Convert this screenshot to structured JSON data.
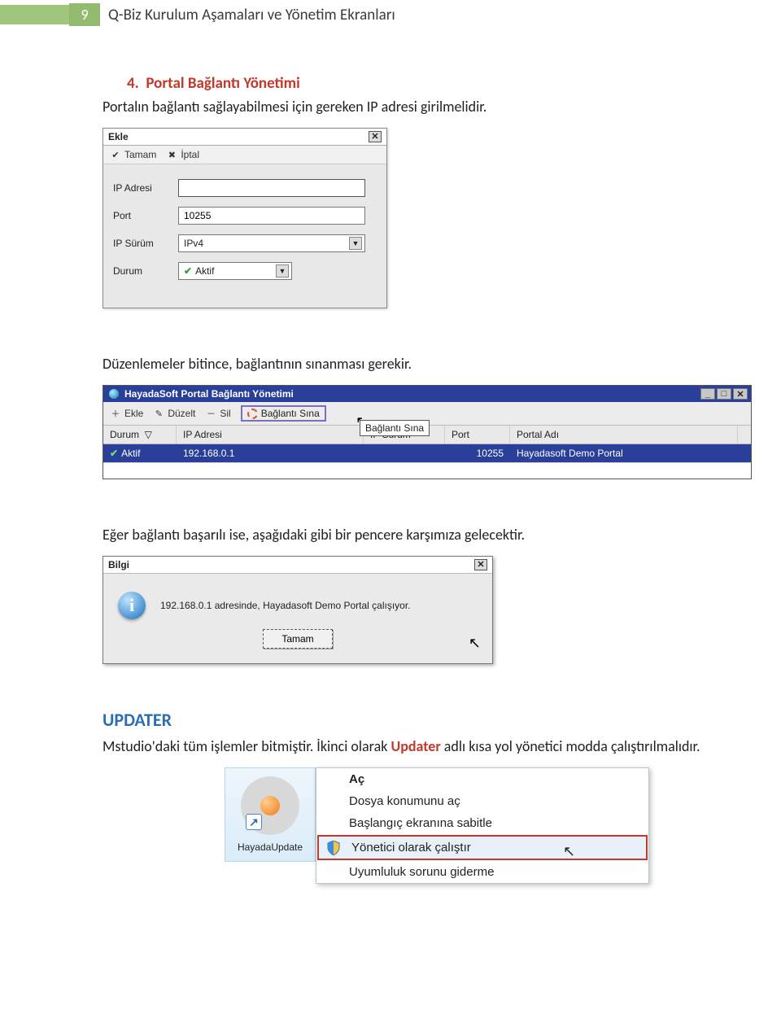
{
  "page": {
    "number": "9",
    "title": "Q-Biz Kurulum Aşamaları ve Yönetim Ekranları"
  },
  "section": {
    "num": "4.",
    "title": "Portal Bağlantı Yönetimi",
    "intro": "Portalın bağlantı sağlayabilmesi için gereken IP adresi girilmelidir."
  },
  "add_dialog": {
    "title": "Ekle",
    "toolbar": {
      "tamam": "Tamam",
      "iptal": "İptal"
    },
    "labels": {
      "ip": "IP Adresi",
      "port": "Port",
      "ipver": "IP Sürüm",
      "durum": "Durum"
    },
    "values": {
      "ip": "",
      "port": "10255",
      "ipver": "IPv4",
      "durum": "Aktif"
    }
  },
  "text_after_add": "Düzenlemeler bitince, bağlantının sınanması gerekir.",
  "mgr": {
    "title": "HayadaSoft Portal Bağlantı Yönetimi",
    "toolbar": {
      "ekle": "Ekle",
      "duzelt": "Düzelt",
      "sil": "Sil",
      "sina": "Bağlantı Sına"
    },
    "tooltip": "Bağlantı Sına",
    "columns": {
      "durum": "Durum",
      "ip": "IP Adresi",
      "ipver": "IP Sürüm",
      "port": "Port",
      "name": "Portal Adı"
    },
    "row": {
      "durum": "Aktif",
      "ip": "192.168.0.1",
      "ipver": "",
      "port": "10255",
      "name": "Hayadasoft Demo Portal"
    }
  },
  "text_success": "Eğer bağlantı başarılı ise, aşağıdaki gibi bir pencere karşımıza gelecektir.",
  "info": {
    "title": "Bilgi",
    "message": "192.168.0.1 adresinde, Hayadasoft Demo Portal çalışıyor.",
    "ok": "Tamam"
  },
  "updater": {
    "heading": "UPDATER",
    "text_pre": "Mstudio'daki tüm işlemler bitmiştir. İkinci olarak ",
    "word": "Updater",
    "text_post": " adlı kısa yol yönetici modda çalıştırılmalıdır."
  },
  "ctx": {
    "shortcut_label": "HayadaUpdate",
    "items": {
      "open": "Aç",
      "open_loc": "Dosya konumunu aç",
      "pin": "Başlangıç ekranına sabitle",
      "runas": "Yönetici olarak çalıştır",
      "compat": "Uyumluluk sorunu giderme"
    }
  }
}
